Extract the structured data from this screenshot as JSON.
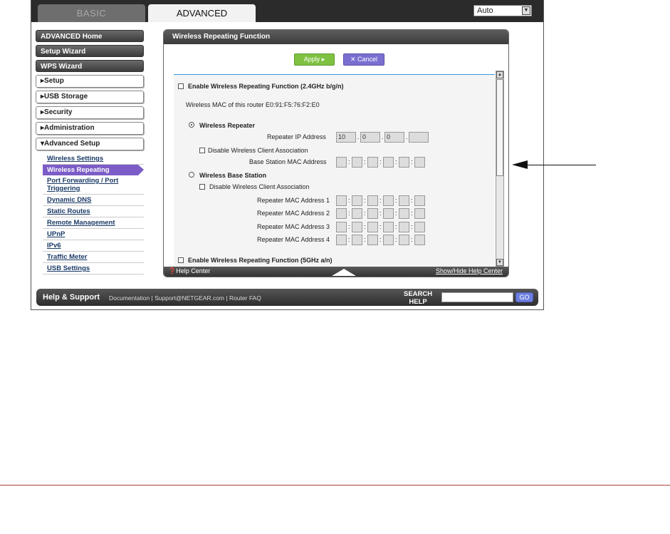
{
  "tabs": {
    "basic": "BASIC",
    "advanced": "ADVANCED"
  },
  "language": {
    "selected": "Auto"
  },
  "sidebar": {
    "dark_items": [
      "ADVANCED Home",
      "Setup Wizard",
      "WPS Wizard"
    ],
    "light_items": [
      "▸Setup",
      "▸USB Storage",
      "▸Security",
      "▸Administration",
      "▾Advanced Setup"
    ],
    "sub_items": [
      "Wireless Settings",
      "Wireless Repeating",
      "Port Forwarding / Port Triggering",
      "Dynamic DNS",
      "Static Routes",
      "Remote Management",
      "UPnP",
      "IPv6",
      "Traffic Meter",
      "USB Settings"
    ],
    "active_sub": "Wireless Repeating"
  },
  "panel": {
    "title": "Wireless Repeating Function",
    "apply": "Apply ▸",
    "cancel": "✕ Cancel",
    "enable_24": "Enable Wireless Repeating Function (2.4GHz b/g/n)",
    "mac_line": "Wireless MAC of this router E0:91:F5:76:F2:E0",
    "repeater": "Wireless Repeater",
    "repeater_ip_label": "Repeater IP Address",
    "repeater_ip": [
      "10",
      "0",
      "0",
      ""
    ],
    "disable_client_assoc": "Disable Wireless Client Association",
    "base_mac_label": "Base Station MAC Address",
    "base_station": "Wireless Base Station",
    "disable_client_assoc_2": "Disable Wireless Client Association",
    "rep_mac_labels": [
      "Repeater MAC Address 1",
      "Repeater MAC Address 2",
      "Repeater MAC Address 3",
      "Repeater MAC Address 4"
    ],
    "enable_5": "Enable Wireless Repeating Function (5GHz a/n)",
    "help_center": "❓Help Center",
    "show_hide": "Show/Hide Help Center"
  },
  "help_bar": {
    "title": "Help & Support",
    "links": "Documentation  |  Support@NETGEAR.com  |  Router FAQ",
    "search_line1": "SEARCH",
    "search_line2": "HELP",
    "go": "GO"
  }
}
